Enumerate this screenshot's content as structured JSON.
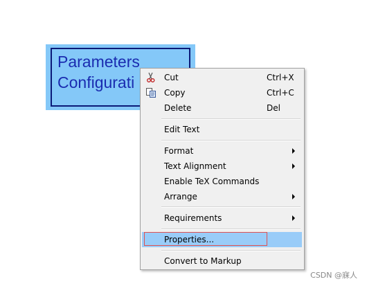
{
  "annotation": {
    "line1": "Parameters",
    "line2": "Configurati",
    "fill_color": "#84c8f8",
    "border_color": "#0b1a78",
    "text_color": "#1a2cb0"
  },
  "context_menu": {
    "items": [
      {
        "label": "Cut",
        "shortcut": "Ctrl+X",
        "icon": "scissors-icon"
      },
      {
        "label": "Copy",
        "shortcut": "Ctrl+C",
        "icon": "copy-icon"
      },
      {
        "label": "Delete",
        "shortcut": "Del"
      },
      {
        "label": "Edit Text"
      },
      {
        "label": "Format",
        "submenu": true
      },
      {
        "label": "Text Alignment",
        "submenu": true
      },
      {
        "label": "Enable TeX Commands"
      },
      {
        "label": "Arrange",
        "submenu": true
      },
      {
        "label": "Requirements",
        "submenu": true
      },
      {
        "label": "Properties...",
        "highlighted": true
      },
      {
        "label": "Convert to Markup"
      }
    ],
    "highlight_color": "#99ccf8"
  },
  "watermark": "CSDN @寐人"
}
